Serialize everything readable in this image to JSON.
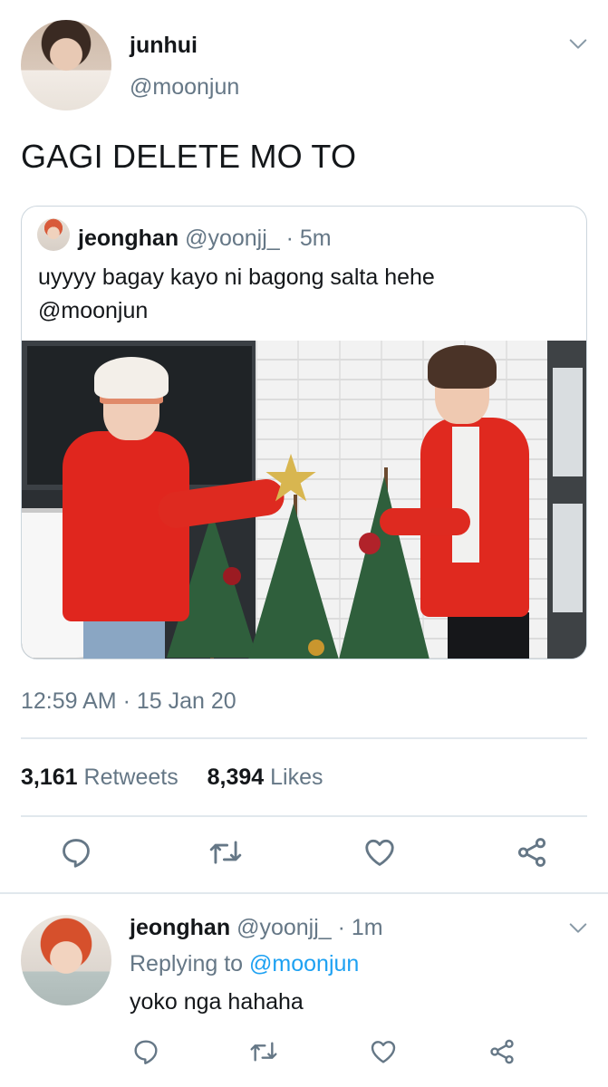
{
  "tweet": {
    "author": {
      "name": "junhui",
      "handle": "@moonjun"
    },
    "text": "GAGI DELETE MO TO",
    "quote": {
      "name": "jeonghan",
      "handle": "@yoonjj_",
      "separator": "·",
      "time": "5m",
      "text_line1": "uyyyy bagay kayo ni bagong salta hehe",
      "text_line2": "@moonjun",
      "media": "photo of two people in red sweaters decorating small christmas trees"
    },
    "timestamp": "12:59 AM · 15 Jan 20",
    "stats": {
      "retweets_count": "3,161",
      "retweets_label": "Retweets",
      "likes_count": "8,394",
      "likes_label": "Likes"
    },
    "actions": [
      "reply-icon",
      "retweet-icon",
      "like-icon",
      "share-icon"
    ]
  },
  "reply": {
    "name": "jeonghan",
    "handle": "@yoonjj_",
    "separator": "·",
    "time": "1m",
    "replying_prefix": "Replying to",
    "replying_to": "@moonjun",
    "text": "yoko nga hahaha",
    "actions": [
      "reply-icon",
      "retweet-icon",
      "like-icon",
      "share-icon"
    ]
  },
  "colors": {
    "text": "#14171a",
    "secondary": "#657786",
    "link": "#1da1f2",
    "border": "#e1e8ed"
  }
}
